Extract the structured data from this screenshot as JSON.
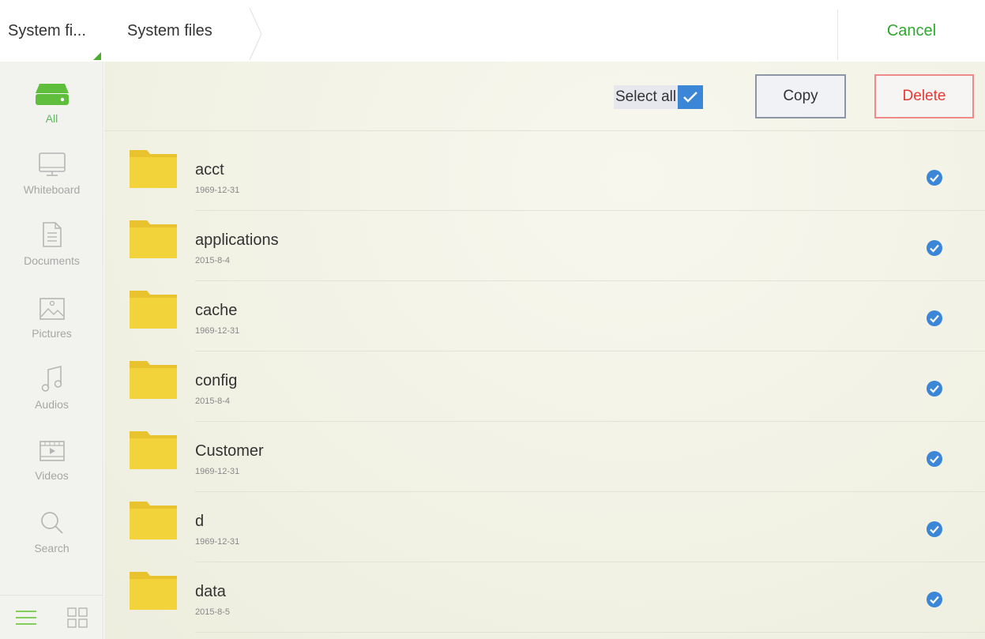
{
  "topbar": {
    "storage_label": "System fi...",
    "breadcrumb": "System files",
    "cancel_label": "Cancel"
  },
  "sidebar": {
    "items": [
      {
        "label": "All",
        "icon": "drive-icon",
        "active": true
      },
      {
        "label": "Whiteboard",
        "icon": "monitor-icon",
        "active": false
      },
      {
        "label": "Documents",
        "icon": "document-icon",
        "active": false
      },
      {
        "label": "Pictures",
        "icon": "picture-icon",
        "active": false
      },
      {
        "label": "Audios",
        "icon": "music-note-icon",
        "active": false
      },
      {
        "label": "Videos",
        "icon": "video-icon",
        "active": false
      },
      {
        "label": "Search",
        "icon": "search-icon",
        "active": false
      }
    ],
    "view_modes": [
      "list-view-icon",
      "grid-view-icon"
    ]
  },
  "actions": {
    "select_all_label": "Select all",
    "select_all_checked": true,
    "copy_label": "Copy",
    "delete_label": "Delete"
  },
  "files": [
    {
      "name": "acct",
      "date": "1969-12-31",
      "selected": true
    },
    {
      "name": "applications",
      "date": "2015-8-4",
      "selected": true
    },
    {
      "name": "cache",
      "date": "1969-12-31",
      "selected": true
    },
    {
      "name": "config",
      "date": "2015-8-4",
      "selected": true
    },
    {
      "name": "Customer",
      "date": "1969-12-31",
      "selected": true
    },
    {
      "name": "d",
      "date": "1969-12-31",
      "selected": true
    },
    {
      "name": "data",
      "date": "2015-8-5",
      "selected": true
    }
  ],
  "colors": {
    "accent_green": "#2ea82e",
    "folder_yellow": "#f2d33a",
    "check_blue": "#3b86d6",
    "delete_red": "#e53935"
  }
}
